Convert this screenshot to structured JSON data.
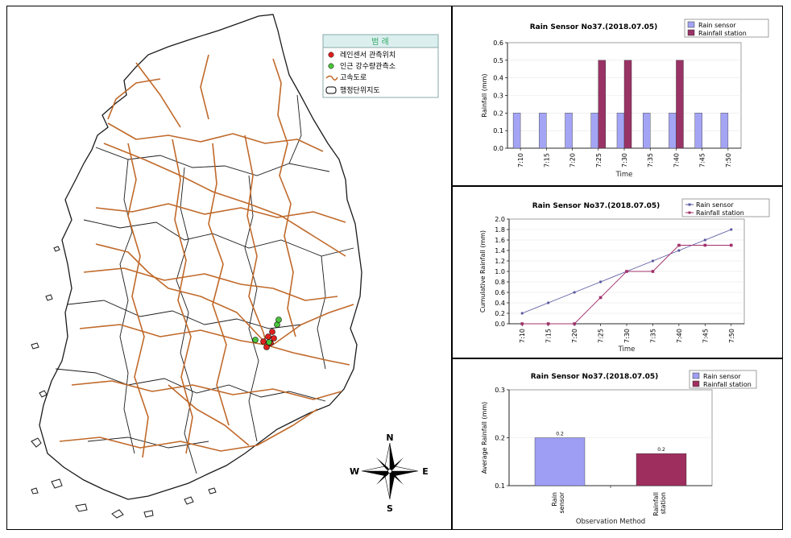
{
  "map": {
    "legend": {
      "title": "범 례",
      "items": [
        {
          "label": "레인센서 관측위치",
          "symbol": "red-dot-icon",
          "color": "#e0201f"
        },
        {
          "label": "인근 강수량관측소",
          "symbol": "green-dot-icon",
          "color": "#4ac33a"
        },
        {
          "label": "고속도로",
          "symbol": "highway-line-icon",
          "color": "#c0692a"
        },
        {
          "label": "행정단위지도",
          "symbol": "boundary-box-icon",
          "color": "#000000"
        }
      ]
    },
    "compass": {
      "n": "N",
      "s": "S",
      "e": "E",
      "w": "W"
    },
    "colors": {
      "highway": "#c0692a",
      "boundary": "#1a1a1a",
      "sensor": "#e0201f",
      "station": "#4ac33a"
    }
  },
  "chart_data": [
    {
      "type": "bar",
      "title": "Rain Sensor No37.(2018.07.05)",
      "xlabel": "Time",
      "ylabel": "Rainfall (mm)",
      "ylim": [
        0,
        0.6
      ],
      "yticks": [
        "0.0",
        "0.1",
        "0.2",
        "0.3",
        "0.4",
        "0.5",
        "0.6"
      ],
      "categories": [
        "7:10",
        "7:15",
        "7:20",
        "7:25",
        "7:30",
        "7:35",
        "7:40",
        "7:45",
        "7:50"
      ],
      "legend_position": "top-right",
      "series": [
        {
          "name": "Rain sensor",
          "color": "#a4a4f5",
          "values": [
            0.2,
            0.2,
            0.2,
            0.2,
            0.2,
            0.2,
            0.2,
            0.2,
            0.2
          ]
        },
        {
          "name": "Rainfall station",
          "color": "#993366",
          "values": [
            0,
            0,
            0,
            0.5,
            0.5,
            0,
            0.5,
            0,
            0
          ]
        }
      ]
    },
    {
      "type": "line",
      "title": "Rain Sensor No37.(2018.07.05)",
      "xlabel": "Time",
      "ylabel": "Cumulative Rainfall (mm)",
      "ylim": [
        0,
        2.0
      ],
      "yticks": [
        "0.0",
        "0.2",
        "0.4",
        "0.6",
        "0.8",
        "1.0",
        "1.2",
        "1.4",
        "1.6",
        "1.8",
        "2.0"
      ],
      "categories": [
        "7:10",
        "7:15",
        "7:20",
        "7:25",
        "7:30",
        "7:35",
        "7:40",
        "7:45",
        "7:50"
      ],
      "legend_position": "top-right",
      "series": [
        {
          "name": "Rain sensor",
          "color": "#5a5aa0",
          "values": [
            0.2,
            0.4,
            0.6,
            0.8,
            1.0,
            1.2,
            1.4,
            1.6,
            1.8
          ]
        },
        {
          "name": "Rainfall station",
          "color": "#a0306a",
          "values": [
            0.0,
            0.0,
            0.0,
            0.5,
            1.0,
            1.0,
            1.5,
            1.5,
            1.5
          ]
        }
      ]
    },
    {
      "type": "bar",
      "title": "Rain Sensor No37.(2018.07.05)",
      "xlabel": "Observation Method",
      "ylabel": "Average Rainfall (mm)",
      "ylim": [
        0.1,
        0.3
      ],
      "yticks": [
        "0.1",
        "0.2",
        "0.3"
      ],
      "categories": [
        "Rain sensor",
        "Rainfall station"
      ],
      "legend_position": "top-right",
      "series": [
        {
          "name": "Rain sensor",
          "color": "#9e9ef5",
          "values": [
            0.2
          ]
        },
        {
          "name": "Rainfall station",
          "color": "#9e2e5e",
          "values": [
            0.167
          ]
        }
      ],
      "data_labels": [
        "0.2",
        "0.2"
      ]
    }
  ]
}
